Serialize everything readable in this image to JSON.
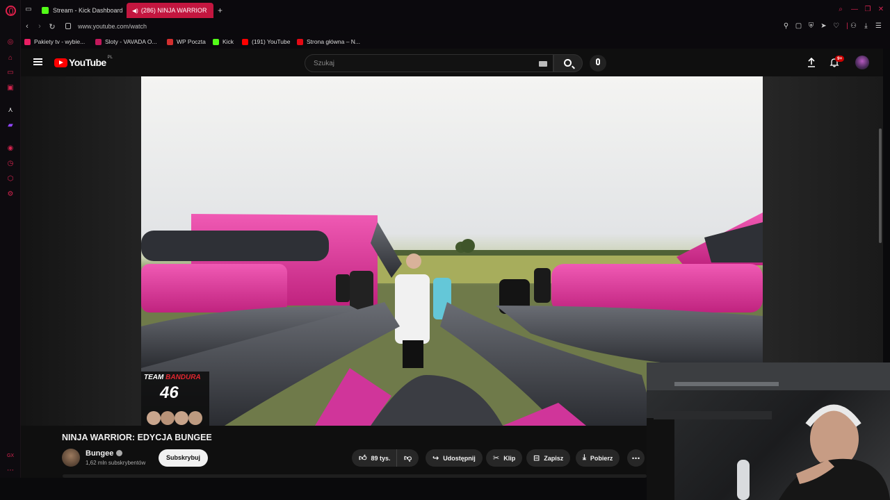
{
  "browser": {
    "tabs": [
      {
        "label": "Stream - Kick Dashboard",
        "favicon_color": "#53fc18"
      },
      {
        "label": "(286) NINJA WARRIOR",
        "favicon_color": "#ff0000"
      }
    ],
    "new_tab_icon": "+",
    "url": "www.youtube.com/watch",
    "bookmarks": [
      {
        "label": "Pakiety tv - wybie...",
        "color": "#e91e63"
      },
      {
        "label": "Sloty - VAVADA O...",
        "color": "#c2185b"
      },
      {
        "label": "WP Poczta",
        "color": "#d32f2f"
      },
      {
        "label": "Kick",
        "color": "#53fc18"
      },
      {
        "label": "(191) YouTube",
        "color": "#ff0000"
      },
      {
        "label": "Strona główna – N...",
        "color": "#e50914"
      }
    ],
    "accent_color": "#c3163f"
  },
  "youtube": {
    "logo_text": "YouTube",
    "region": "PL",
    "search_placeholder": "Szukaj",
    "notification_badge": "9+",
    "video": {
      "overlay_team_prefix": "TEAM",
      "overlay_team_name": "BANDURA",
      "overlay_score": "46"
    },
    "title": "NINJA WARRIOR: EDYCJA BUNGEE",
    "channel": {
      "name": "Bungee",
      "subscribers": "1,62 mln subskrybentów",
      "subscribe_label": "Subskrybuj"
    },
    "actions": {
      "likes": "89 tys.",
      "share": "Udostępnij",
      "clip": "Klip",
      "save": "Zapisz",
      "download": "Pobierz"
    }
  }
}
